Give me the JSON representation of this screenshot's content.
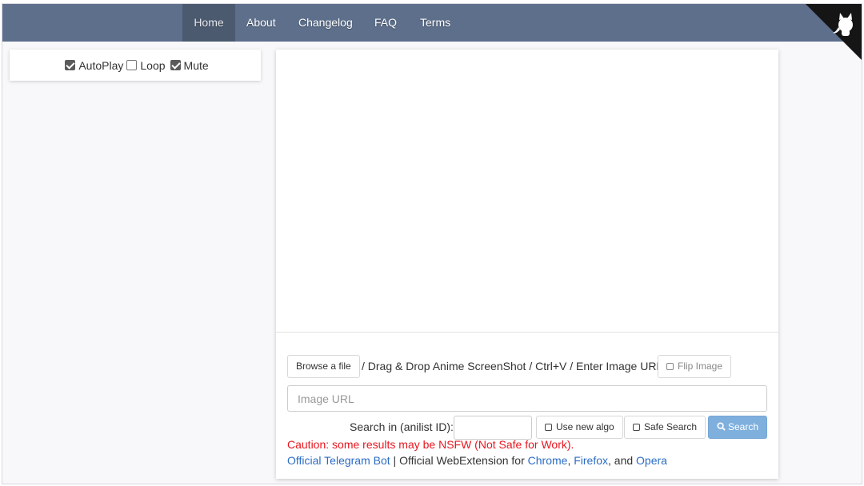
{
  "nav": {
    "items": [
      {
        "label": "Home",
        "active": true
      },
      {
        "label": "About",
        "active": false
      },
      {
        "label": "Changelog",
        "active": false
      },
      {
        "label": "FAQ",
        "active": false
      },
      {
        "label": "Terms",
        "active": false
      }
    ],
    "corner_icon": "octocat-icon"
  },
  "player_options": {
    "autoplay": {
      "label": "AutoPlay",
      "checked": true
    },
    "loop": {
      "label": "Loop",
      "checked": false
    },
    "mute": {
      "label": "Mute",
      "checked": true
    }
  },
  "search": {
    "browse_label": "Browse a file",
    "instructions": "/ Drag & Drop Anime ScreenShot / Ctrl+V / Enter Image URL",
    "flip_label": "Flip Image",
    "url_placeholder": "Image URL",
    "anilist_label": "Search in (anilist ID):",
    "new_algo_label": "Use new algo",
    "safe_search_label": "Safe Search",
    "search_label": "Search",
    "caution": "Caution: some results may be NSFW (Not Safe for Work).",
    "footer": {
      "telegram": "Official Telegram Bot",
      "separator": "|",
      "webext_prefix": "Official WebExtension for",
      "chrome": "Chrome",
      "comma": ",",
      "firefox": "Firefox",
      "and": ", and",
      "opera": "Opera"
    }
  },
  "colors": {
    "navbar": "#5d6f8b",
    "nav_active": "#4c5a70",
    "primary_button": "#7fb0dd",
    "caution": "#e8161e",
    "link": "#2b6cc4"
  }
}
